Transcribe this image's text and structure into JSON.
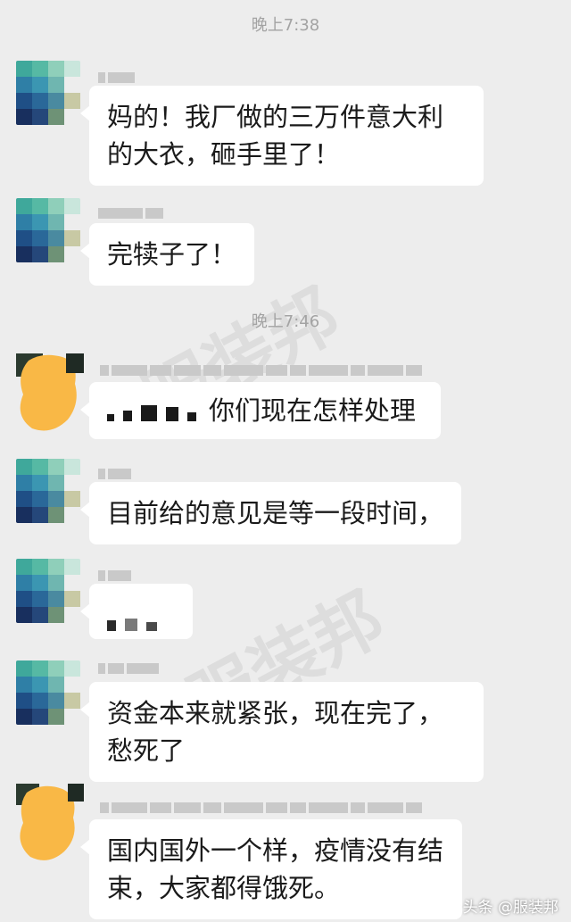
{
  "times": [
    "晚上7:38",
    "晚上7:46"
  ],
  "messages": [
    {
      "text": "妈的！我厂做的三万件意大利的大衣，砸手里了！"
    },
    {
      "text": "完犊子了！"
    },
    {
      "text": "你们现在怎样处理"
    },
    {
      "text": "目前给的意见是等一段时间，"
    },
    {
      "text": ""
    },
    {
      "text": "资金本来就紧张，现在完了，愁死了"
    },
    {
      "text": "国内国外一个样，疫情没有结束，大家都得饿死。"
    }
  ],
  "watermark": "服装邦",
  "footer": {
    "source": "头条 @服装邦"
  },
  "colors": {
    "background": "#ededed",
    "bubble": "#ffffff",
    "time": "#a3a3a3"
  }
}
